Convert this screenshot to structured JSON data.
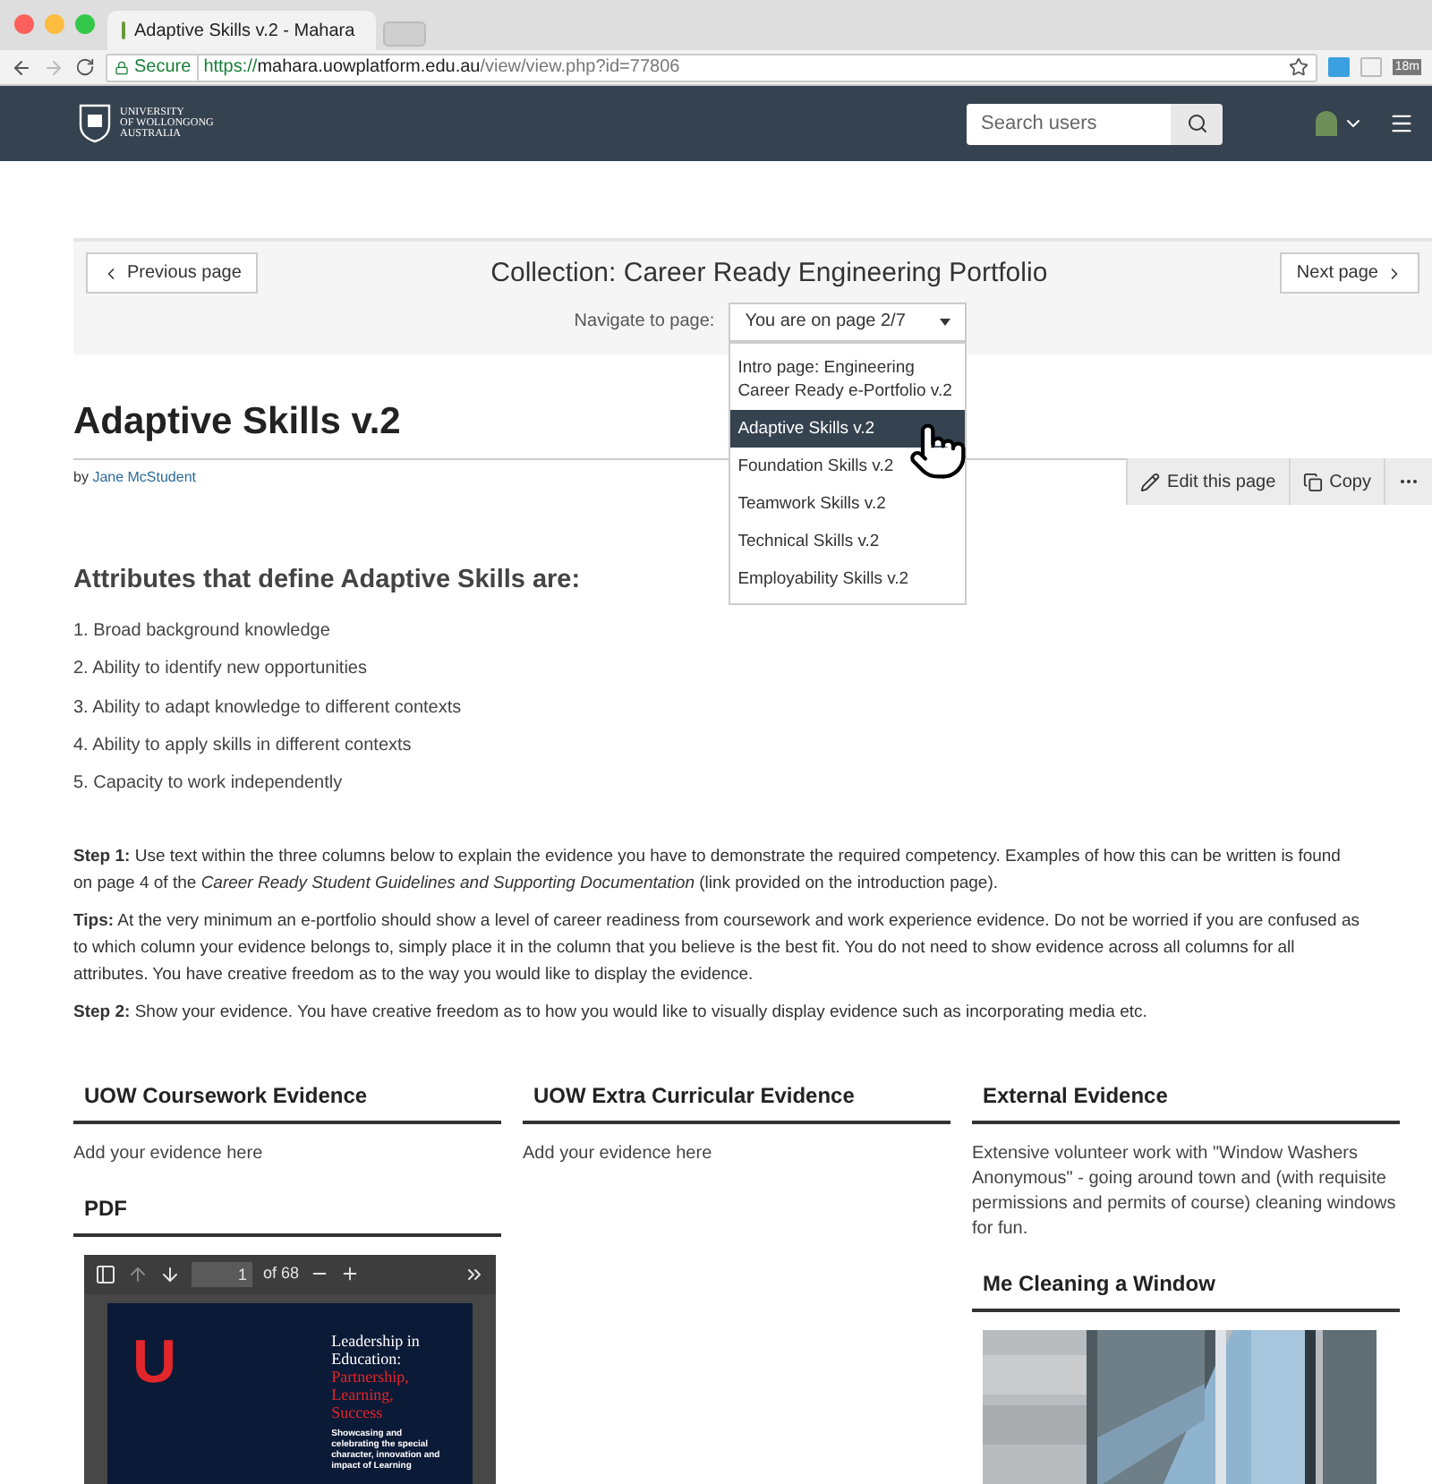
{
  "browser": {
    "tab_title": "Adaptive Skills v.2 - Mahara",
    "secure_label": "Secure",
    "url_scheme": "https://",
    "url_host": "mahara.uowplatform.edu.au",
    "url_path": "/view/view.php?id=77806",
    "extension_badge": "18m"
  },
  "navbar": {
    "logo_lines": [
      "UNIVERSITY",
      "OF WOLLONGONG",
      "AUSTRALIA"
    ],
    "search": {
      "placeholder": "Search users"
    }
  },
  "collection": {
    "title": "Collection: Career Ready Engineering Portfolio",
    "previous": "Previous page",
    "next": "Next page",
    "navigate_label": "Navigate to page:",
    "select_value": "You are on page 2/7",
    "options": [
      {
        "label": "Intro page: Engineering Career Ready e-Portfolio v.2",
        "selected": false
      },
      {
        "label": "Adaptive Skills v.2",
        "selected": true
      },
      {
        "label": "Foundation Skills v.2",
        "selected": false
      },
      {
        "label": "Teamwork Skills v.2",
        "selected": false
      },
      {
        "label": "Technical Skills v.2",
        "selected": false
      },
      {
        "label": "Employability Skills v.2",
        "selected": false
      }
    ]
  },
  "page": {
    "title": "Adaptive Skills v.2",
    "by": "by",
    "author": "Jane McStudent",
    "actions": [
      {
        "kind": "edit",
        "label": "Edit this page"
      },
      {
        "kind": "copy",
        "label": "Copy"
      },
      {
        "kind": "more"
      }
    ]
  },
  "attributes": {
    "heading": "Attributes that define Adaptive Skills are:",
    "items": [
      "1. Broad background knowledge",
      "2. Ability to identify new opportunities",
      "3. Ability to adapt knowledge to different contexts",
      "4. Ability to apply skills in different contexts",
      "5. Capacity to work independently"
    ]
  },
  "instructions": [
    "**Step 1:** Use text within the three columns below to explain the evidence you have to demonstrate the required competency. Examples of how this can be written is found on page 4 of the *Career Ready Student Guidelines and Supporting Documentation* (link provided on the introduction page).",
    "**Tips:** At the very minimum an e-portfolio should show a level of career readiness from coursework and work experience evidence. Do not be worried if you are confused as to which column your evidence belongs to, simply place it in the column that you believe is the best fit. You do not need to show evidence across all columns for all attributes. You have creative freedom as to the way you would like to display the evidence.",
    "**Step 2:** Show your evidence. You have creative freedom as to how you would like to visually display evidence such as incorporating media etc."
  ],
  "columns": [
    {
      "blocks": [
        {
          "kind": "text",
          "heading": "UOW Coursework Evidence",
          "text": "Add your evidence here"
        },
        {
          "kind": "pdf",
          "heading": "PDF",
          "page_number": "1",
          "page_count": "of 68",
          "cover": {
            "logo": "U",
            "title": "Leadership in Education:",
            "subtitle": "Partnership, Learning, Success",
            "blurb": "Showcasing and celebrating the special character, innovation and impact of Learning"
          }
        }
      ]
    },
    {
      "blocks": [
        {
          "kind": "text",
          "heading": "UOW Extra Curricular Evidence",
          "text": "Add your evidence here"
        }
      ]
    },
    {
      "blocks": [
        {
          "kind": "text",
          "heading": "External Evidence",
          "text": "Extensive volunteer work with \"Window Washers Anonymous\" - going around town and (with requisite permissions and permits of course) cleaning windows for fun."
        },
        {
          "heading": "Me Cleaning a Window"
        }
      ]
    }
  ]
}
